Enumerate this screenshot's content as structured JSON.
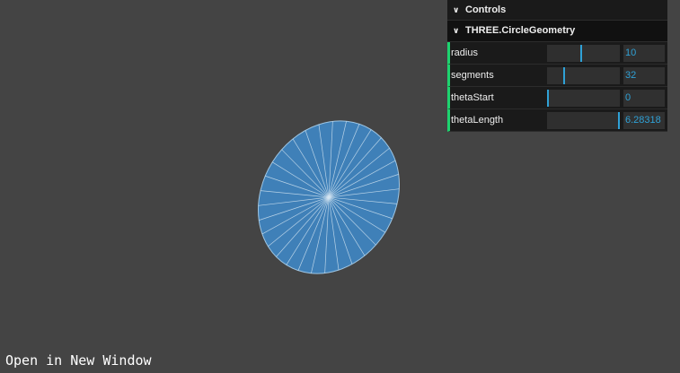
{
  "link": {
    "open_in_new_window": "Open in New Window"
  },
  "gui": {
    "title": "Controls",
    "folder": {
      "title": "THREE.CircleGeometry",
      "params": [
        {
          "label": "radius",
          "value": "10",
          "level": 0.47
        },
        {
          "label": "segments",
          "value": "32",
          "level": 0.24
        },
        {
          "label": "thetaStart",
          "value": "0",
          "level": 0.0
        },
        {
          "label": "thetaLength",
          "value": "6.28318",
          "level": 1.0
        }
      ]
    }
  },
  "colors": {
    "background": "#444444",
    "mesh_fill": "#3f80b8",
    "wireframe": "#d6e6f2",
    "gui_bg": "#1a1a1a",
    "number_accent": "#2fa1d6",
    "row_border": "#1ed36f"
  },
  "scene": {
    "object": "circle-geometry",
    "segments": 32
  }
}
